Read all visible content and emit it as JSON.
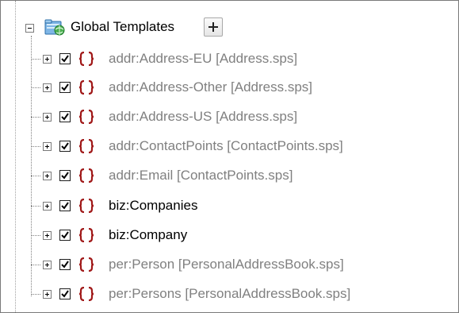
{
  "root": {
    "label": "Global Templates",
    "expanded": true,
    "add_button_icon": "plus-icon",
    "folder_icon": "global-templates-folder-icon"
  },
  "templates": [
    {
      "label": "addr:Address-EU [Address.sps]",
      "checked": true,
      "style": "dim"
    },
    {
      "label": "addr:Address-Other [Address.sps]",
      "checked": true,
      "style": "dim"
    },
    {
      "label": "addr:Address-US [Address.sps]",
      "checked": true,
      "style": "dim"
    },
    {
      "label": "addr:ContactPoints [ContactPoints.sps]",
      "checked": true,
      "style": "dim"
    },
    {
      "label": "addr:Email [ContactPoints.sps]",
      "checked": true,
      "style": "dim"
    },
    {
      "label": "biz:Companies",
      "checked": true,
      "style": "dark"
    },
    {
      "label": "biz:Company",
      "checked": true,
      "style": "dark"
    },
    {
      "label": "per:Person [PersonalAddressBook.sps]",
      "checked": true,
      "style": "dim"
    },
    {
      "label": "per:Persons [PersonalAddressBook.sps]",
      "checked": true,
      "style": "dim"
    }
  ],
  "colors": {
    "dim_text": "#808080",
    "dark_text": "#000000",
    "brace": "#a01818",
    "folder_blue": "#3a8fd4",
    "globe_green": "#3aa84a"
  }
}
